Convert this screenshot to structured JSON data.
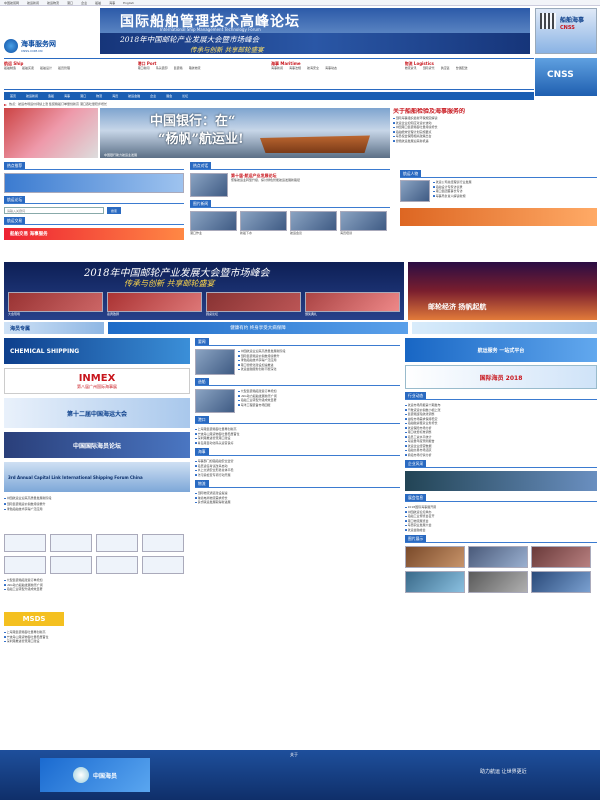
{
  "topnav": {
    "links": [
      "中国航贸网",
      "航运新闻",
      "航运物流",
      "港口",
      "企业",
      "船舶",
      "海事",
      "English"
    ]
  },
  "header": {
    "banner_title": "国际船舶管理技术高峰论坛",
    "banner_subtitle": "International Ship Management Technology Forum",
    "ribbon_text": "2018年中国邮轮产业发展大会暨市场峰会",
    "ribbon_sub": "传承与创新 共享邮轮盛宴",
    "logo_text": "海事服务网",
    "logo_sub": "CNSS.COM.CN",
    "right_ad_title": "船舶海事",
    "right_ad_sub": "CNSS"
  },
  "channel_grid": {
    "groups": [
      {
        "head": "航运 Ship",
        "items": [
          "船舶制造",
          "船舶买卖",
          "船舶设计",
          "船员管理"
        ]
      },
      {
        "head": "港口 Port",
        "items": [
          "港口新闻",
          "码头装卸",
          "集装箱",
          "港航物流"
        ]
      },
      {
        "head": "海事 Maritime",
        "items": [
          "海事新闻",
          "海事法规",
          "航海安全",
          "海事动态"
        ]
      },
      {
        "head": "物流 Logistics",
        "items": [
          "物流资讯",
          "国际货代",
          "供应链",
          "仓储配送"
        ]
      }
    ]
  },
  "main_nav": {
    "items": [
      "首页",
      "航运新闻",
      "造船",
      "海事",
      "港口",
      "物流",
      "海员",
      "航运金融",
      "企业",
      "展会",
      "论坛"
    ]
  },
  "ticker": "热点：航运市场运价持续上涨 集装箱船订单量创新高 港口吞吐量稳步增长",
  "hero": {
    "line1": "中国银行：在“",
    "line2": "“杨帆”航运业!",
    "caption": "中国银行助力航运业发展"
  },
  "headline": {
    "title": "关于船舶检验及海事服务的",
    "items": [
      "国际海事组织最新环保规定解读",
      "航运企业如何应对运价波动",
      "中国港口集装箱吞吐量持续增长",
      "船舶能效管理计划实施要点",
      "海员权益保障相关政策出台",
      "智能航运发展迎来新机遇"
    ]
  },
  "sidebar_left": {
    "section1": "热点推荐",
    "section2": "航运论坛",
    "search_label": "搜索",
    "search_placeholder": "请输入关键词",
    "section3": "航运交易",
    "promo": "船舶交易 海事服务"
  },
  "center_col": {
    "section1": "热点对话",
    "feature_title": "第十届·航运产业发展论坛",
    "feature_text": "聚焦航运业转型升级，探讨绿色智能航运发展新路径",
    "section2": "图片新闻",
    "captions": [
      "港口作业",
      "新船下水",
      "航运会议",
      "海员培训"
    ]
  },
  "right_col": {
    "section1": "航运人物",
    "items": [
      "航运公司总经理谈行业发展",
      "船舶设计专家访谈录",
      "港口集团董事长专访",
      "海事局负责人解读新规"
    ]
  },
  "mid_banner": {
    "line1": "2018年中国邮轮产业发展大会暨市场峰会",
    "line2": "传承与创新 共享邮轮盛宴",
    "photo_caps": [
      "大会现场",
      "嘉宾致辞",
      "圆桌论坛",
      "颁奖典礼"
    ],
    "right_text": "邮轮经济 扬帆起航"
  },
  "strip": {
    "left": "海员专属",
    "center": "健康有约 终身享受大病保障"
  },
  "news_block": {
    "sections": [
      {
        "head": "要闻",
        "items": [
          "中国航运业迎来高质量发展新阶段",
          "国际集装箱运价指数持续攀升",
          "绿色船舶技术获得广泛应用",
          "港口智能化建设加速推进",
          "航运金融服务创新不断深化"
        ]
      },
      {
        "head": "造船",
        "items": [
          "大型集装箱船建造订单增加",
          "LNG动力船舶发展前景广阔",
          "船舶工业转型升级成效显著",
          "海洋工程装备市场回暖"
        ]
      },
      {
        "head": "港口",
        "items": [
          "上海港集装箱吞吐量再创新高",
          "宁波舟山港货物吞吐量稳居首位",
          "深圳港推进智慧港口建设",
          "青岛港自动化码头运营良好"
        ]
      },
      {
        "head": "海事",
        "items": [
          "海事部门加强船舶安全监管",
          "船员适任考试改革启动",
          "水上交通安全形势总体平稳",
          "防污染检查专项行动开展"
        ]
      },
      {
        "head": "物流",
        "items": [
          "国际物流通道建设提速",
          "跨境电商物流需求增长",
          "多式联运发展取得新进展"
        ]
      }
    ]
  },
  "left_ads": {
    "ad1": "CHEMICAL SHIPPING",
    "ad2": "INMEX",
    "ad2_sub": "第八届广州国际海事展",
    "ad3": "第十二届中国海运大会",
    "ad4": "中国国际海员论坛",
    "ad5": "3rd Annual Capital Link International Shipping Forum China",
    "ad6": "MSDS"
  },
  "right_lists": {
    "promo1": "航运服务 一站式平台",
    "promo2": "国际海员 2018",
    "section1": "行业动态",
    "items1": [
      "航运市场周报第十期发布",
      "干散货运价指数小幅上涨",
      "集装箱班轮航线调整",
      "油轮市场需求保持稳定",
      "船舶融资租赁业务增长",
      "航运保险市场分析",
      "港口收费标准调整",
      "船员工资水平统计",
      "海运量年度预测报告",
      "航运企业经营数据",
      "船舶交易市场活跃",
      "拆船市场行情分析"
    ],
    "section2": "企业风采",
    "section3": "展会信息",
    "items3": [
      "2018国际海事展开幕",
      "中国航运论坛举办",
      "船舶工业博览会召开",
      "港口物流展览会",
      "海员职业发展大会",
      "航运金融峰会"
    ],
    "section4": "图片展示"
  },
  "footer": {
    "logo": "中国海员",
    "label": "关于",
    "slogan": "助力航运 让世界更近"
  }
}
